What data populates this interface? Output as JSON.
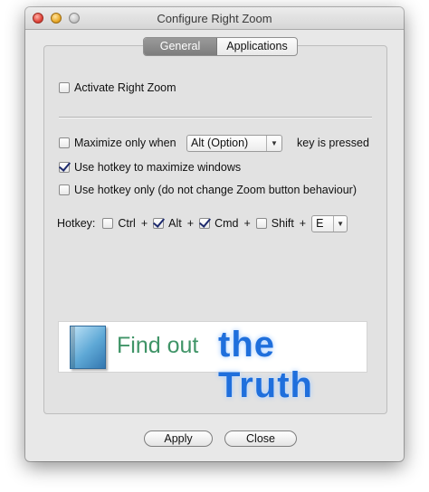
{
  "window": {
    "title": "Configure Right Zoom"
  },
  "tabs": [
    {
      "label": "General",
      "selected": true
    },
    {
      "label": "Applications",
      "selected": false
    }
  ],
  "general": {
    "activate": {
      "label": "Activate Right Zoom",
      "checked": false
    },
    "maximize_only_when": {
      "label": "Maximize only when",
      "checked": false,
      "key_value": "Alt (Option)",
      "suffix": "key is pressed"
    },
    "use_hotkey": {
      "label": "Use hotkey to maximize windows",
      "checked": true
    },
    "hotkey_only": {
      "label": "Use hotkey only (do not change Zoom button behaviour)",
      "checked": false
    },
    "hotkey": {
      "label": "Hotkey:",
      "ctrl": {
        "label": "Ctrl",
        "checked": false
      },
      "alt": {
        "label": "Alt",
        "checked": true
      },
      "cmd": {
        "label": "Cmd",
        "checked": true
      },
      "shift": {
        "label": "Shift",
        "checked": false
      },
      "plus": "+",
      "key_value": "E"
    }
  },
  "banner": {
    "left_text": "Find out",
    "right_text": "the Truth"
  },
  "buttons": {
    "apply": "Apply",
    "close": "Close"
  },
  "colors": {
    "banner_green": "#3f9467",
    "banner_blue": "#1f6fdc",
    "checkmark": "#1e2b6e"
  }
}
